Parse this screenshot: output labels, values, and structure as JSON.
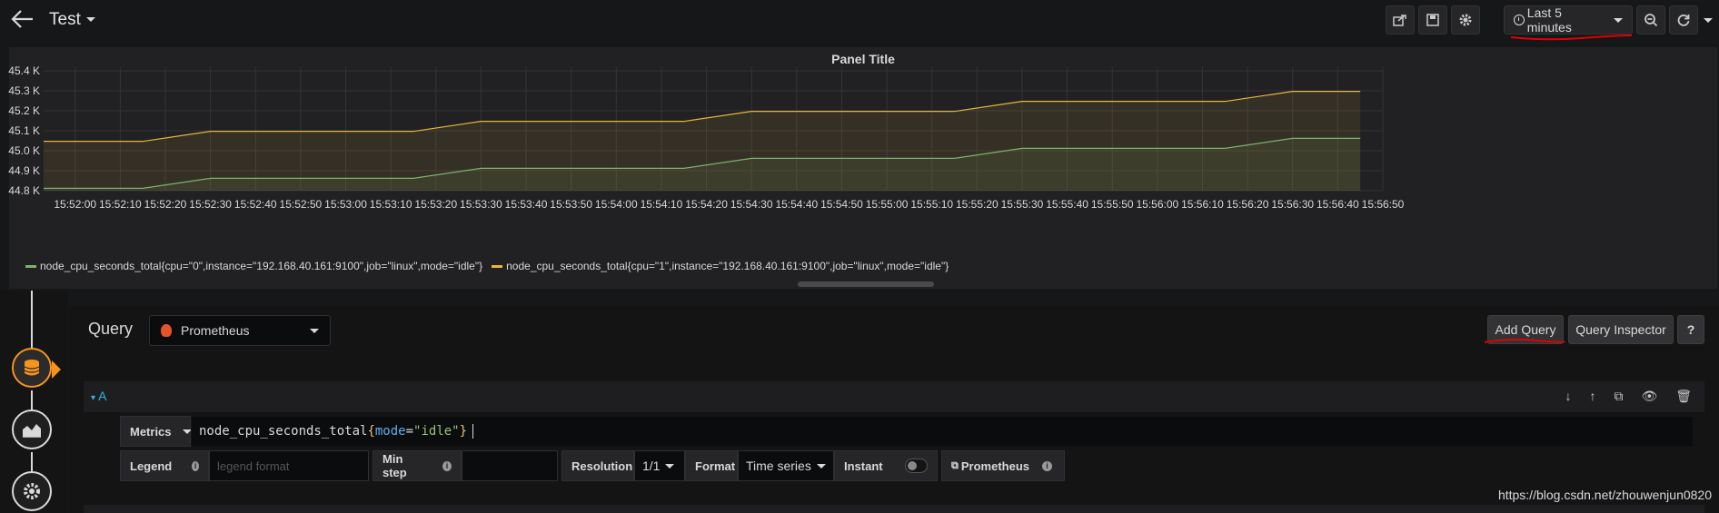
{
  "header": {
    "back_label": "←",
    "dashboard_title": "Test",
    "time_range": "Last 5 minutes"
  },
  "panel": {
    "title": "Panel Title"
  },
  "chart_data": {
    "type": "line",
    "title": "Panel Title",
    "y_ticks": [
      "45.4 K",
      "45.3 K",
      "45.2 K",
      "45.1 K",
      "45.0 K",
      "44.9 K",
      "44.8 K"
    ],
    "ylim": [
      44800,
      45400
    ],
    "x_ticks": [
      "15:52:00",
      "15:52:10",
      "15:52:20",
      "15:52:30",
      "15:52:40",
      "15:52:50",
      "15:53:00",
      "15:53:10",
      "15:53:20",
      "15:53:30",
      "15:53:40",
      "15:53:50",
      "15:54:00",
      "15:54:10",
      "15:54:20",
      "15:54:30",
      "15:54:40",
      "15:54:50",
      "15:55:00",
      "15:55:10",
      "15:55:20",
      "15:55:30",
      "15:55:40",
      "15:55:50",
      "15:56:00",
      "15:56:10",
      "15:56:20",
      "15:56:30",
      "15:56:40",
      "15:56:50"
    ],
    "xlim": [
      "15:51:53",
      "15:56:50"
    ],
    "grid": true,
    "legend_placement": "bottom-left",
    "series": [
      {
        "name": "node_cpu_seconds_total{cpu=\"0\",instance=\"192.168.40.161:9100\",job=\"linux\",mode=\"idle\"}",
        "color": "#7eb26d",
        "points": [
          [
            "15:51:53",
            44812
          ],
          [
            "15:52:15",
            44812
          ],
          [
            "15:52:30",
            44862
          ],
          [
            "15:53:15",
            44862
          ],
          [
            "15:53:30",
            44912
          ],
          [
            "15:54:15",
            44912
          ],
          [
            "15:54:30",
            44962
          ],
          [
            "15:55:15",
            44962
          ],
          [
            "15:55:30",
            45012
          ],
          [
            "15:56:15",
            45012
          ],
          [
            "15:56:30",
            45062
          ],
          [
            "15:56:45",
            45062
          ]
        ]
      },
      {
        "name": "node_cpu_seconds_total{cpu=\"1\",instance=\"192.168.40.161:9100\",job=\"linux\",mode=\"idle\"}",
        "color": "#eab839",
        "points": [
          [
            "15:51:53",
            45047
          ],
          [
            "15:52:15",
            45047
          ],
          [
            "15:52:30",
            45097
          ],
          [
            "15:53:15",
            45097
          ],
          [
            "15:53:30",
            45147
          ],
          [
            "15:54:15",
            45147
          ],
          [
            "15:54:30",
            45197
          ],
          [
            "15:55:15",
            45197
          ],
          [
            "15:55:30",
            45247
          ],
          [
            "15:56:15",
            45247
          ],
          [
            "15:56:30",
            45297
          ],
          [
            "15:56:45",
            45297
          ]
        ]
      }
    ]
  },
  "legend": [
    {
      "label": "node_cpu_seconds_total{cpu=\"0\",instance=\"192.168.40.161:9100\",job=\"linux\",mode=\"idle\"}",
      "color": "#7eb26d"
    },
    {
      "label": "node_cpu_seconds_total{cpu=\"1\",instance=\"192.168.40.161:9100\",job=\"linux\",mode=\"idle\"}",
      "color": "#eab839"
    }
  ],
  "query": {
    "title": "Query",
    "datasource": "Prometheus",
    "add_query": "Add Query",
    "query_inspector": "Query Inspector",
    "help": "?",
    "row_label": "A",
    "metrics_label": "Metrics",
    "metrics_prefix": "node_cpu_seconds_total",
    "metrics_brace_open": "{",
    "metrics_key": "mode",
    "metrics_eq": "=",
    "metrics_value": "\"idle\"",
    "metrics_brace_close": "}",
    "legend_label": "Legend",
    "legend_placeholder": "legend format",
    "min_step_label": "Min step",
    "resolution_label": "Resolution",
    "resolution_value": "1/1",
    "format_label": "Format",
    "format_value": "Time series",
    "instant_label": "Instant",
    "prometheus_link": "Prometheus"
  },
  "watermark": "https://blog.csdn.net/zhouwenjun0820"
}
